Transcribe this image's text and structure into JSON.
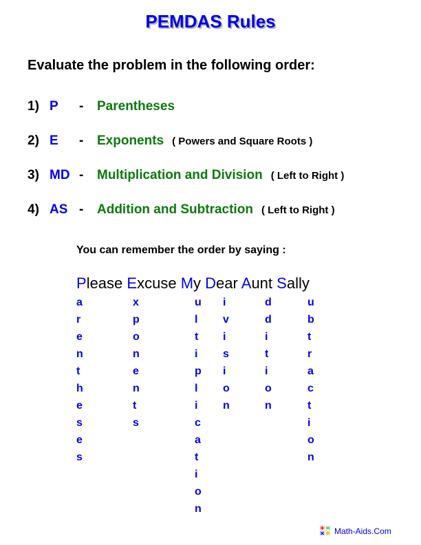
{
  "title": "PEMDAS Rules",
  "intro": "Evaluate the problem in the following order:",
  "rules": [
    {
      "num": "1)",
      "abbr": "P",
      "dash": "-",
      "name": "Parentheses",
      "note": ""
    },
    {
      "num": "2)",
      "abbr": "E",
      "dash": "-",
      "name": "Exponents",
      "note": "( Powers and Square Roots )"
    },
    {
      "num": "3)",
      "abbr": "MD",
      "dash": "-",
      "name": "Multiplication and Division",
      "note": "( Left to Right )"
    },
    {
      "num": "4)",
      "abbr": "AS",
      "dash": "-",
      "name": "Addition and Subtraction",
      "note": "( Left to Right )"
    }
  ],
  "remember": "You can remember the order by saying :",
  "phrase": [
    {
      "cap": "P",
      "rest": "lease"
    },
    {
      "cap": "E",
      "rest": "xcuse"
    },
    {
      "cap": "M",
      "rest": "y"
    },
    {
      "cap": "D",
      "rest": "ear"
    },
    {
      "cap": "A",
      "rest": "unt"
    },
    {
      "cap": "S",
      "rest": "ally"
    }
  ],
  "columns": [
    "arentheses",
    "xponents",
    "ultiplication",
    "ivision",
    "ddition",
    "ubtraction"
  ],
  "footer": "Math-Aids.Com",
  "colors": {
    "blue": "#0000ee",
    "green": "#0a7a0a",
    "black": "#000000"
  }
}
